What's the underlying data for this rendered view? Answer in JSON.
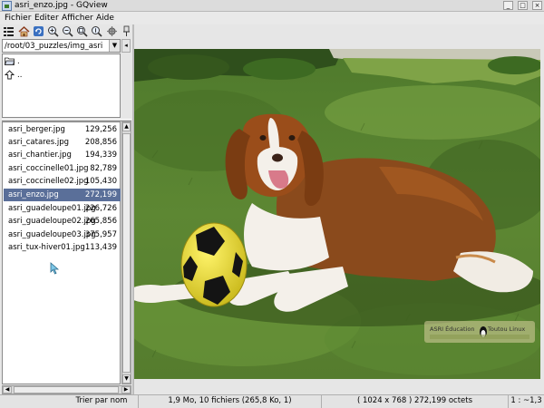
{
  "window": {
    "title": "asri_enzo.jpg - GQview",
    "buttons": [
      "_",
      "□",
      "×"
    ]
  },
  "menu": [
    "Fichier",
    "Editer",
    "Afficher",
    "Aide"
  ],
  "toolbar": [
    "thumbnails-icon",
    "home-icon",
    "refresh-icon",
    "zoom-in-icon",
    "zoom-out-icon",
    "zoom-fit-icon",
    "zoom-100-icon",
    "settings-icon",
    "floating-icon"
  ],
  "path": {
    "value": "/root/03_puzzles/img_asri"
  },
  "dirs": [
    {
      "icon": "folder-open-icon",
      "label": "."
    },
    {
      "icon": "folder-up-icon",
      "label": ".."
    }
  ],
  "files": [
    {
      "name": "asri_berger.jpg",
      "size": "129,256",
      "selected": false
    },
    {
      "name": "asri_catares.jpg",
      "size": "208,856",
      "selected": false
    },
    {
      "name": "asri_chantier.jpg",
      "size": "194,339",
      "selected": false
    },
    {
      "name": "asri_coccinelle01.jpg",
      "size": "82,789",
      "selected": false
    },
    {
      "name": "asri_coccinelle02.jpg",
      "size": "105,430",
      "selected": false
    },
    {
      "name": "asri_enzo.jpg",
      "size": "272,199",
      "selected": true
    },
    {
      "name": "asri_guadeloupe01.jpg",
      "size": "226,726",
      "selected": false
    },
    {
      "name": "asri_guadeloupe02.jpg",
      "size": "265,856",
      "selected": false
    },
    {
      "name": "asri_guadeloupe03.jpg",
      "size": "375,957",
      "selected": false
    },
    {
      "name": "asri_tux-hiver01.jpg",
      "size": "113,439",
      "selected": false
    }
  ],
  "image": {
    "watermark_line1": "ASRI Éducation",
    "watermark_line2": "Toutou Linux",
    "selection_color": "#5a6f99"
  },
  "status": {
    "sort": "Trier par nom",
    "summary": "1,9 Mo, 10 fichiers (265,8 Ko, 1)",
    "image_info": "( 1024 x 768 ) 272,199 octets",
    "zoom": "1 : ~1,3"
  }
}
